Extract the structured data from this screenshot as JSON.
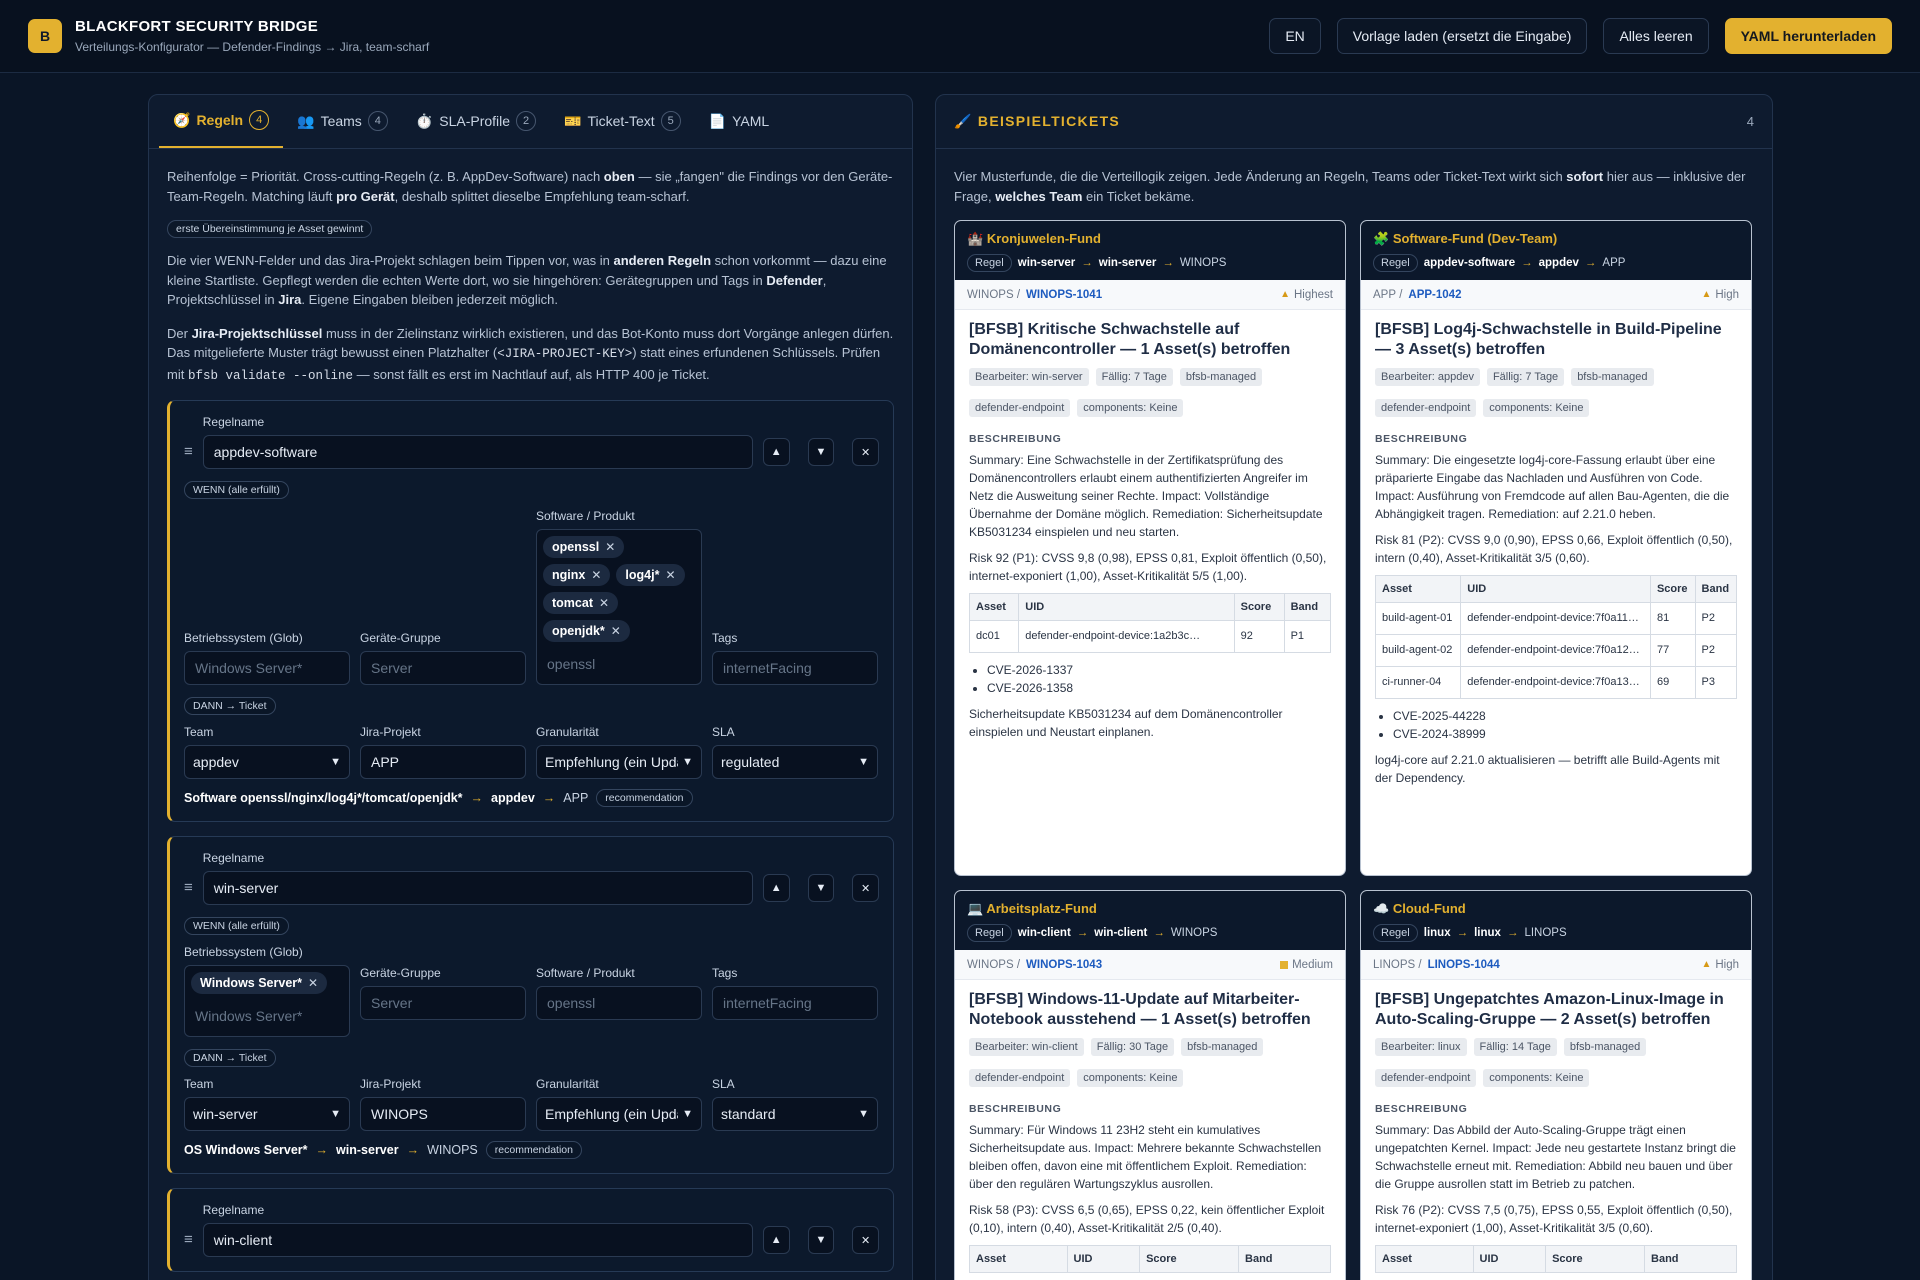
{
  "header": {
    "logo": "B",
    "title": "BLACKFORT SECURITY BRIDGE",
    "subtitle": "Verteilungs-Konfigurator — Defender-Findings → Jira, team-scharf",
    "buttons": {
      "lang": "EN",
      "template": "Vorlage laden (ersetzt die Eingabe)",
      "clear": "Alles leeren",
      "download": "YAML herunterladen"
    }
  },
  "tabs": [
    {
      "icon": "🧭",
      "label": "Regeln",
      "count": "4"
    },
    {
      "icon": "👥",
      "label": "Teams",
      "count": "4"
    },
    {
      "icon": "⏱️",
      "label": "SLA-Profile",
      "count": "2"
    },
    {
      "icon": "🎫",
      "label": "Ticket-Text",
      "count": "5"
    },
    {
      "icon": "📄",
      "label": "YAML",
      "count": ""
    }
  ],
  "rules_intro": {
    "p1a": "Reihenfolge = Priorität. Cross-cutting-Regeln (z. B. AppDev-Software) nach ",
    "p1b": "oben",
    "p1c": " — sie „fangen\" die Findings vor den Geräte-Team-Regeln. Matching läuft ",
    "p1d": "pro Gerät",
    "p1e": ", deshalb splittet dieselbe Empfehlung team-scharf.",
    "pill": "erste Übereinstimmung je Asset gewinnt",
    "p2a": "Die vier WENN-Felder und das Jira-Projekt schlagen beim Tippen vor, was in ",
    "p2b": "anderen Regeln",
    "p2c": " schon vorkommt — dazu eine kleine Startliste. Gepflegt werden die echten Werte dort, wo sie hingehören: Gerätegruppen und Tags in ",
    "p2d": "Defender",
    "p2e": ", Projektschlüssel in ",
    "p2f": "Jira",
    "p2g": ". Eigene Eingaben bleiben jederzeit möglich.",
    "p3a": "Der ",
    "p3b": "Jira-Projektschlüssel",
    "p3c": " muss in der Zielinstanz wirklich existieren, und das Bot-Konto muss dort Vorgänge anlegen dürfen. Das mitgelieferte Muster trägt bewusst einen Platzhalter (",
    "p3d": "<JIRA-PROJECT-KEY>",
    "p3e": ") statt eines erfundenen Schlüssels. Prüfen mit ",
    "p3f": "bfsb validate --online",
    "p3g": " — sonst fällt es erst im Nachtlauf auf, als HTTP 400 je Ticket."
  },
  "labels": {
    "rule_name": "Regelname",
    "when": "WENN (alle erfüllt)",
    "then": "DANN → Ticket",
    "os": "Betriebssystem (Glob)",
    "group": "Geräte-Gruppe",
    "software": "Software / Produkt",
    "tags": "Tags",
    "team": "Team",
    "jira": "Jira-Projekt",
    "gran": "Granularität",
    "sla": "SLA",
    "ph_os": "Windows Server*",
    "ph_group": "Server",
    "ph_software": "openssl",
    "ph_tags": "internetFacing",
    "recommendation": "recommendation",
    "up": "▲",
    "down": "▼",
    "delete": "✕",
    "drag": "≡",
    "remove": "✕"
  },
  "rules": [
    {
      "name": "appdev-software",
      "software": [
        "openssl",
        "nginx",
        "log4j*",
        "tomcat",
        "openjdk*"
      ],
      "team": "appdev",
      "jira": "APP",
      "gran": "Empfehlung (ein Update)",
      "sla": "regulated",
      "summary_a": "Software openssl/nginx/log4j*/tomcat/openjdk*",
      "summary_team": "appdev",
      "summary_proj": "APP"
    },
    {
      "name": "win-server",
      "os": [
        "Windows Server*"
      ],
      "team": "win-server",
      "jira": "WINOPS",
      "gran": "Empfehlung (ein Update)",
      "sla": "standard",
      "summary_a": "OS Windows Server*",
      "summary_team": "win-server",
      "summary_proj": "WINOPS"
    },
    {
      "name": "win-client"
    }
  ],
  "tickets_panel": {
    "title": "BEISPIELTICKETS",
    "count": "4",
    "intro_a": "Vier Musterfunde, die die Verteillogik zeigen. Jede Änderung an Regeln, Teams oder Ticket-Text wirkt sich ",
    "intro_b": "sofort",
    "intro_c": " hier aus — inklusive der Frage, ",
    "intro_d": "welches Team",
    "intro_e": " ein Ticket bekäme.",
    "regel": "Regel",
    "desc": "BESCHREIBUNG",
    "th": [
      "Asset",
      "UID",
      "Score",
      "Band"
    ]
  },
  "tickets": [
    {
      "icon": "🏰",
      "title": "Kronjuwelen-Fund",
      "rule": "win-server",
      "team": "win-server",
      "proj": "WINOPS",
      "proj_label": "WINOPS",
      "key": "WINOPS-1041",
      "priority": "Highest",
      "heading": "[BFSB] Kritische Schwachstelle auf Domänencontroller — 1 Asset(s) betroffen",
      "tags": [
        "Bearbeiter: win-server",
        "Fällig: 7 Tage",
        "bfsb-managed",
        "defender-endpoint",
        "components: Keine"
      ],
      "summary": "Summary: Eine Schwachstelle in der Zertifikatsprüfung des Domänencontrollers erlaubt einem authentifizierten Angreifer im Netz die Ausweitung seiner Rechte. Impact: Vollständige Übernahme der Domäne möglich. Remediation: Sicherheitsupdate KB5031234 einspielen und neu starten.",
      "risk": "Risk 92 (P1): CVSS 9,8 (0,98), EPSS 0,81, Exploit öffentlich (0,50), internet-exponiert (1,00), Asset-Kritikalität 5/5 (1,00).",
      "rows": [
        [
          "dc01",
          "defender-endpoint-device:1a2b3c…",
          "92",
          "P1"
        ]
      ],
      "cves": [
        "CVE-2026-1337",
        "CVE-2026-1358"
      ],
      "footer": "Sicherheitsupdate KB5031234 auf dem Domänencontroller einspielen und Neustart einplanen."
    },
    {
      "icon": "🧩",
      "title": "Software-Fund (Dev-Team)",
      "rule": "appdev-software",
      "team": "appdev",
      "proj": "APP",
      "proj_label": "APP",
      "key": "APP-1042",
      "priority": "High",
      "heading": "[BFSB] Log4j-Schwachstelle in Build-Pipeline — 3 Asset(s) betroffen",
      "tags": [
        "Bearbeiter: appdev",
        "Fällig: 7 Tage",
        "bfsb-managed",
        "defender-endpoint",
        "components: Keine"
      ],
      "summary": "Summary: Die eingesetzte log4j-core-Fassung erlaubt über eine präparierte Eingabe das Nachladen und Ausführen von Code. Impact: Ausführung von Fremdcode auf allen Bau-Agenten, die die Abhängigkeit tragen. Remediation: auf 2.21.0 heben.",
      "risk": "Risk 81 (P2): CVSS 9,0 (0,90), EPSS 0,66, Exploit öffentlich (0,50), intern (0,40), Asset-Kritikalität 3/5 (0,60).",
      "rows": [
        [
          "build-agent-01",
          "defender-endpoint-device:7f0a11…",
          "81",
          "P2"
        ],
        [
          "build-agent-02",
          "defender-endpoint-device:7f0a12…",
          "77",
          "P2"
        ],
        [
          "ci-runner-04",
          "defender-endpoint-device:7f0a13…",
          "69",
          "P3"
        ]
      ],
      "cves": [
        "CVE-2025-44228",
        "CVE-2024-38999"
      ],
      "footer": "log4j-core auf 2.21.0 aktualisieren — betrifft alle Build-Agents mit der Dependency."
    },
    {
      "icon": "💻",
      "title": "Arbeitsplatz-Fund",
      "rule": "win-client",
      "team": "win-client",
      "proj": "WINOPS",
      "proj_label": "WINOPS",
      "key": "WINOPS-1043",
      "priority": "Medium",
      "heading": "[BFSB] Windows-11-Update auf Mitarbeiter-Notebook ausstehend — 1 Asset(s) betroffen",
      "tags": [
        "Bearbeiter: win-client",
        "Fällig: 30 Tage",
        "bfsb-managed",
        "defender-endpoint",
        "components: Keine"
      ],
      "summary": "Summary: Für Windows 11 23H2 steht ein kumulatives Sicherheitsupdate aus. Impact: Mehrere bekannte Schwachstellen bleiben offen, davon eine mit öffentlichem Exploit. Remediation: über den regulären Wartungszyklus ausrollen.",
      "risk": "Risk 58 (P3): CVSS 6,5 (0,65), EPSS 0,22, kein öffentlicher Exploit (0,10), intern (0,40), Asset-Kritikalität 2/5 (0,40).",
      "rows": [],
      "cves": [],
      "footer": ""
    },
    {
      "icon": "☁️",
      "title": "Cloud-Fund",
      "rule": "linux",
      "team": "linux",
      "proj": "LINOPS",
      "proj_label": "LINOPS",
      "key": "LINOPS-1044",
      "priority": "High",
      "heading": "[BFSB] Ungepatchtes Amazon-Linux-Image in Auto-Scaling-Gruppe — 2 Asset(s) betroffen",
      "tags": [
        "Bearbeiter: linux",
        "Fällig: 14 Tage",
        "bfsb-managed",
        "defender-endpoint",
        "components: Keine"
      ],
      "summary": "Summary: Das Abbild der Auto-Scaling-Gruppe trägt einen ungepatchten Kernel. Impact: Jede neu gestartete Instanz bringt die Schwachstelle erneut mit. Remediation: Abbild neu bauen und über die Gruppe ausrollen statt im Betrieb zu patchen.",
      "risk": "Risk 76 (P2): CVSS 7,5 (0,75), EPSS 0,55, Exploit öffentlich (0,50), internet-exponiert (1,00), Asset-Kritikalität 3/5 (0,60).",
      "rows": [],
      "cves": [],
      "footer": ""
    }
  ]
}
